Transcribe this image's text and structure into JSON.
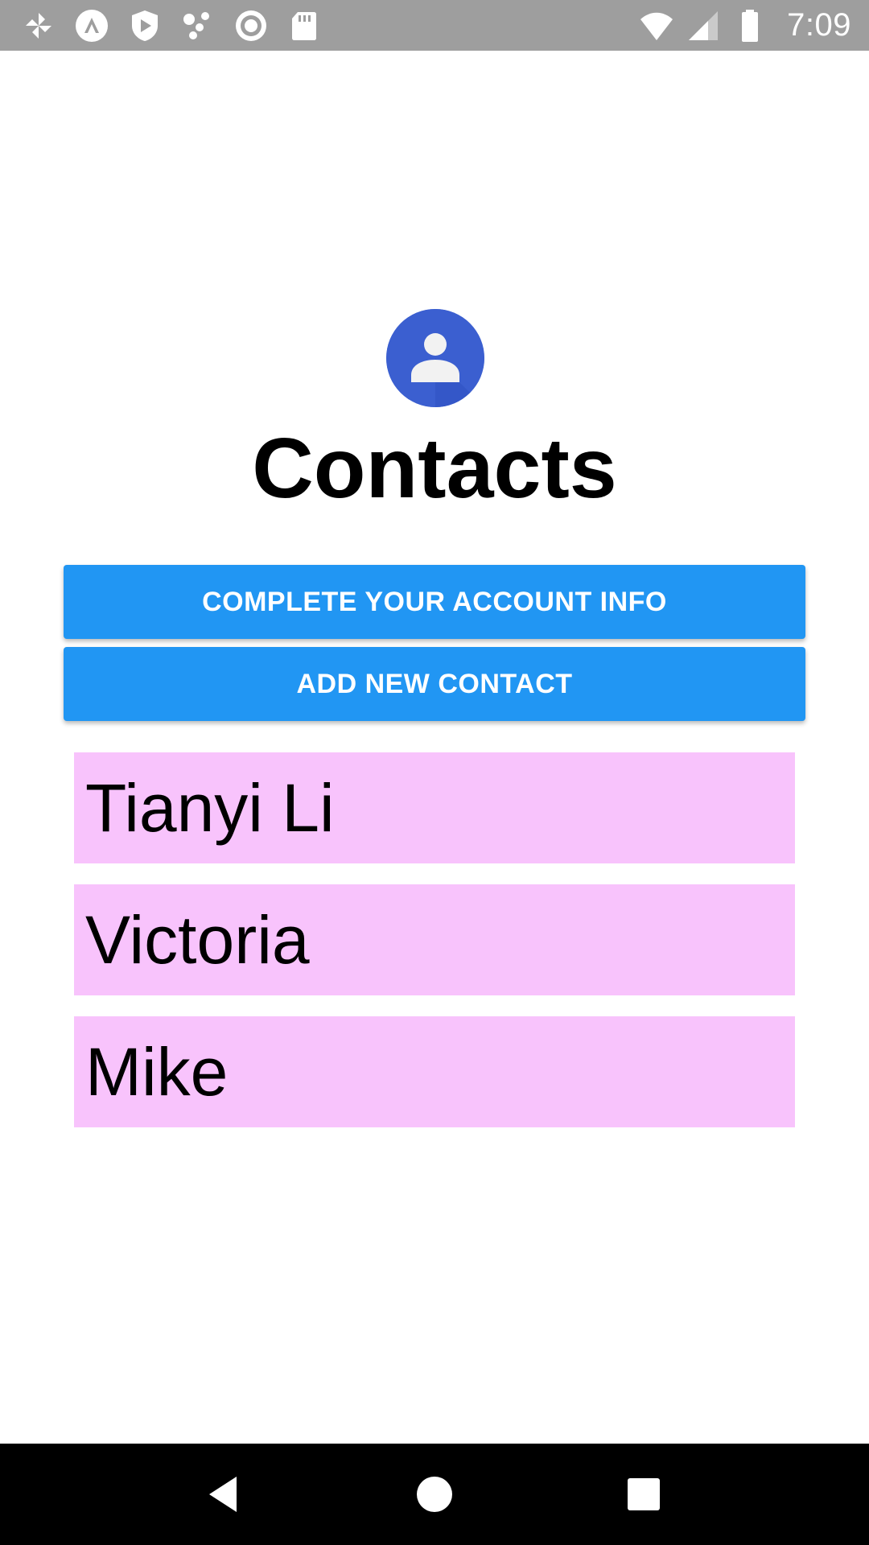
{
  "status_bar": {
    "time": "7:09",
    "left_icons": [
      "pinwheel-icon",
      "expo-icon",
      "play-protect-icon",
      "network-dots-icon",
      "record-icon",
      "sd-card-icon"
    ],
    "right_icons": [
      "wifi-icon",
      "signal-icon",
      "battery-icon"
    ]
  },
  "header": {
    "icon": "contacts-app-icon",
    "title": "Contacts"
  },
  "buttons": {
    "account_info": "COMPLETE YOUR ACCOUNT INFO",
    "add_contact": "ADD NEW CONTACT"
  },
  "contacts": [
    {
      "name": "Tianyi Li"
    },
    {
      "name": "Victoria"
    },
    {
      "name": "Mike"
    }
  ],
  "nav_bar": {
    "icons": [
      "back-icon",
      "home-icon",
      "recents-icon"
    ]
  },
  "colors": {
    "status_bar": "#9e9e9e",
    "button": "#2196f3",
    "contact_item": "#f8c3fc",
    "header_icon": "#3b5fd0",
    "nav_bar": "#000000"
  }
}
